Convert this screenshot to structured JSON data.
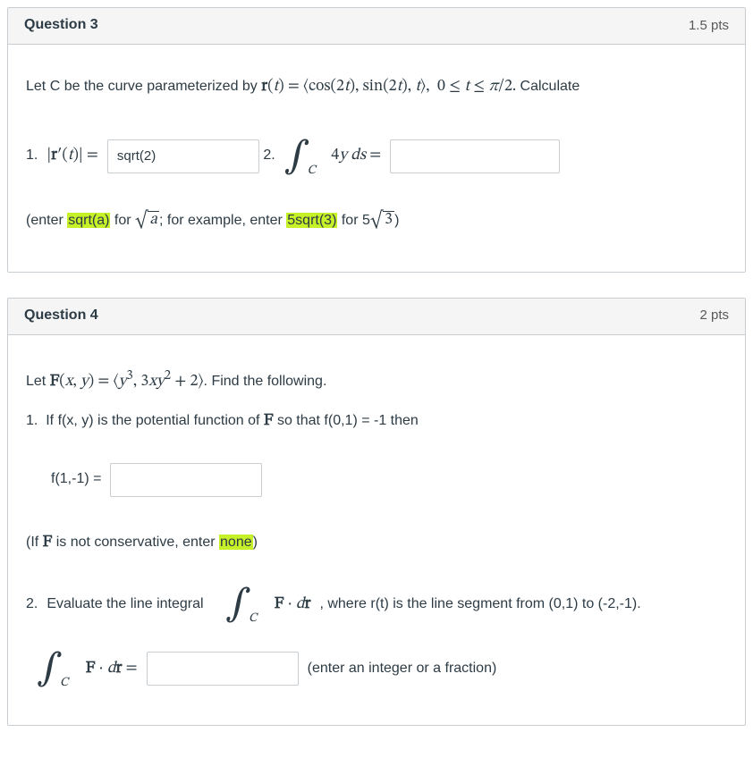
{
  "q3": {
    "title": "Question 3",
    "pts": "1.5 pts",
    "intro_pre": "Let C be the curve parameterized by ",
    "param_eq": "r(t) = ⟨cos(2t), sin(2t), t⟩,  0 ≤ t ≤ π/2.",
    "intro_post": "  Calculate",
    "part1_num": "1.",
    "part1_lhs": "|r′(t)| =",
    "part1_value": "sqrt(2)",
    "part2_num": "2.",
    "part2_integrand": "4y ds =",
    "hint_pre": "(enter ",
    "hint_sqrt": "sqrt(a)",
    "hint_mid": " for ",
    "hint_rad": "a",
    "hint_post": "; for example, enter ",
    "hint_example": "5sqrt(3)",
    "hint_for": " for 5",
    "hint_rad2": "3",
    "hint_close": ")"
  },
  "q4": {
    "title": "Question 4",
    "pts": "2 pts",
    "intro_pre": "Let ",
    "vecfield": "F(x, y) = ⟨y³, 3xy² + 2⟩",
    "intro_post": ". Find the following.",
    "part1_num": "1.",
    "part1_text": "If f(x, y) is the potential function of ",
    "part1_bold": "F",
    "part1_text2": " so that f(0,1) = -1  then",
    "part1_lhs": "f(1,-1) =",
    "cons_hint_pre": "(If ",
    "cons_hint_bold": "F",
    "cons_hint_mid": " is not conservative, enter ",
    "cons_hint_none": "none",
    "cons_hint_close": ")",
    "part2_num": "2.",
    "part2_text": "Evaluate the line integral ",
    "part2_int": "F · dr",
    "part2_where": ", where r(t) is the line segment from (0,1) to (-2,-1).",
    "part2_lhs": "F · dr =",
    "part2_hint": "(enter an integer or a fraction)"
  }
}
